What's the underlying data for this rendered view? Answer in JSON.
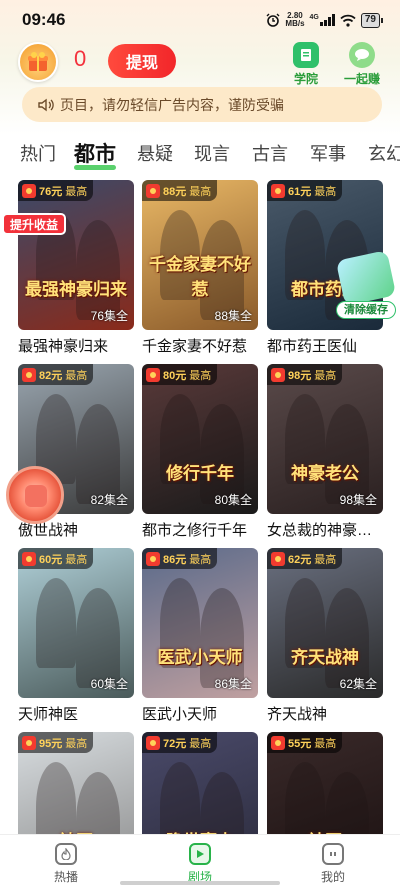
{
  "status_bar": {
    "time": "09:46",
    "net_speed": "2.80",
    "net_unit": "MB/s",
    "network": "4G",
    "battery": "79"
  },
  "header": {
    "coin_value": "0",
    "withdraw_label": "提现",
    "college_label": "学院",
    "earn_label": "一起赚"
  },
  "notice": {
    "text": "页目，请勿轻信广告内容，谨防受骗"
  },
  "tabs": [
    "热门",
    "都市",
    "悬疑",
    "现言",
    "古言",
    "军事",
    "玄幻"
  ],
  "active_tab": "都市",
  "price_suffix": "最高",
  "dramas": [
    {
      "title": "最强神豪归来",
      "price": "76元",
      "episodes": "76集全",
      "art": "最强神豪归来",
      "bg1": "#3a4a6a",
      "bg2": "#8a2a1a"
    },
    {
      "title": "千金家妻不好惹",
      "price": "88元",
      "episodes": "88集全",
      "art": "千金家妻不好惹",
      "bg1": "#e9b866",
      "bg2": "#8a5a2a"
    },
    {
      "title": "都市药王医仙",
      "price": "61元",
      "episodes": "",
      "art": "都市药王",
      "bg1": "#4a5a6a",
      "bg2": "#1a2a3a"
    },
    {
      "title": "傲世战神",
      "price": "82元",
      "episodes": "82集全",
      "art": "",
      "bg1": "#9aa6b0",
      "bg2": "#3a3a3a"
    },
    {
      "title": "都市之修行千年",
      "price": "80元",
      "episodes": "80集全",
      "art": "修行千年",
      "bg1": "#5a3a3a",
      "bg2": "#1a1a1a"
    },
    {
      "title": "女总裁的神豪…",
      "price": "98元",
      "episodes": "98集全",
      "art": "神豪老公",
      "bg1": "#5a4a4a",
      "bg2": "#2a2020"
    },
    {
      "title": "天师神医",
      "price": "60元",
      "episodes": "60集全",
      "art": "",
      "bg1": "#b0d0d8",
      "bg2": "#4a5a5a"
    },
    {
      "title": "医武小天师",
      "price": "86元",
      "episodes": "86集全",
      "art": "医武小天师",
      "bg1": "#5a6a8a",
      "bg2": "#c0a0a0"
    },
    {
      "title": "齐天战神",
      "price": "62元",
      "episodes": "62集全",
      "art": "齐天战神",
      "bg1": "#6a7080",
      "bg2": "#2a2a2a"
    },
    {
      "title": "",
      "price": "95元",
      "episodes": "",
      "art": "神医",
      "bg1": "#d8dde0",
      "bg2": "#8a8a8a"
    },
    {
      "title": "",
      "price": "72元",
      "episodes": "",
      "art": "隐世豪少",
      "bg1": "#4a4a6a",
      "bg2": "#2a2a3a"
    },
    {
      "title": "",
      "price": "55元",
      "episodes": "",
      "art": "神医",
      "bg1": "#3a2a2a",
      "bg2": "#1a1010"
    }
  ],
  "overlays": {
    "boost_label": "提升收益",
    "clear_cache_label": "清除缓存"
  },
  "bottom_nav": [
    {
      "label": "热播",
      "icon": "fire-icon"
    },
    {
      "label": "剧场",
      "icon": "play-icon"
    },
    {
      "label": "我的",
      "icon": "profile-icon"
    }
  ],
  "active_nav": "剧场",
  "colors": {
    "accent_red": "#f2262a",
    "accent_green": "#29b34a",
    "price_gold": "#ffd25a"
  }
}
